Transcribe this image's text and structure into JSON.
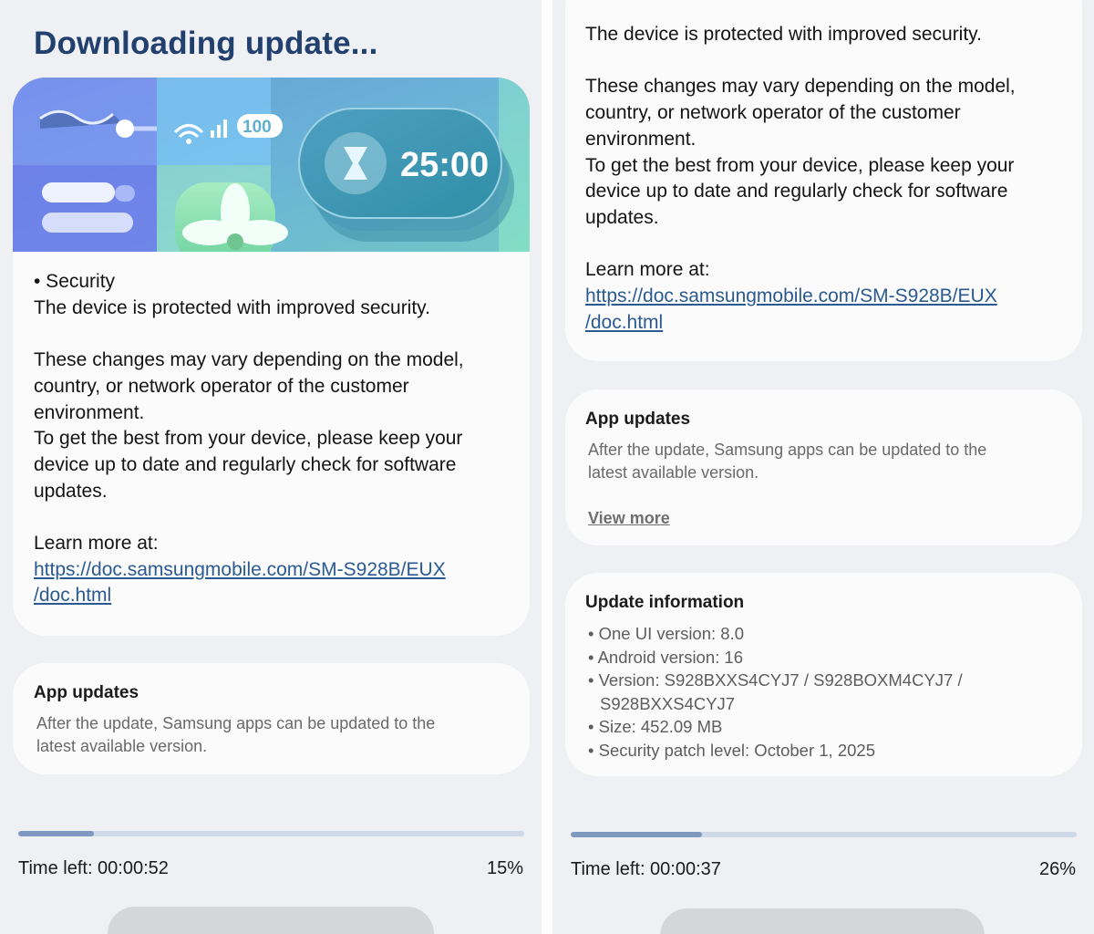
{
  "left": {
    "title": "Downloading update...",
    "banner": {
      "timer": "25:00",
      "battery": "100"
    },
    "notes": {
      "security_heading": "• Security",
      "security_text": "The device is protected with improved security.",
      "variance_lines": [
        "These changes may vary depending on the model,",
        "country, or network operator of the customer",
        "environment.",
        "To get the best from your device, please keep your",
        "device up to date and regularly check for software",
        "updates."
      ],
      "learn_more": "Learn more at:",
      "link_line1": "https://doc.samsungmobile.com/SM-S928B/EUX",
      "link_line2": "/doc.html"
    },
    "app_updates": {
      "title": "App updates",
      "line1": "After the update, Samsung apps can be updated to the",
      "line2": "latest available version."
    },
    "progress": {
      "fraction": 0.15,
      "time_left": "Time left: 00:00:52",
      "percent": "15%"
    }
  },
  "right": {
    "notes": {
      "security_text": "The device is protected with improved security.",
      "variance_lines": [
        "These changes may vary depending on the model,",
        "country, or network operator of the customer",
        "environment.",
        "To get the best from your device, please keep your",
        "device up to date and regularly check for software",
        "updates."
      ],
      "learn_more": "Learn more at:",
      "link_line1": "https://doc.samsungmobile.com/SM-S928B/EUX",
      "link_line2": "/doc.html"
    },
    "app_updates": {
      "title": "App updates",
      "line1": "After the update, Samsung apps can be updated to the",
      "line2": "latest available version.",
      "view_more": "View more"
    },
    "update_info": {
      "title": "Update information",
      "items": [
        "• One UI version: 8.0",
        "• Android version: 16",
        "• Version: S928BXXS4CYJ7 / S928BOXM4CYJ7 /",
        "S928BXXS4CYJ7",
        "• Size: 452.09 MB",
        "• Security patch level: October 1, 2025"
      ]
    },
    "progress": {
      "fraction": 0.26,
      "time_left": "Time left: 00:00:37",
      "percent": "26%"
    }
  }
}
